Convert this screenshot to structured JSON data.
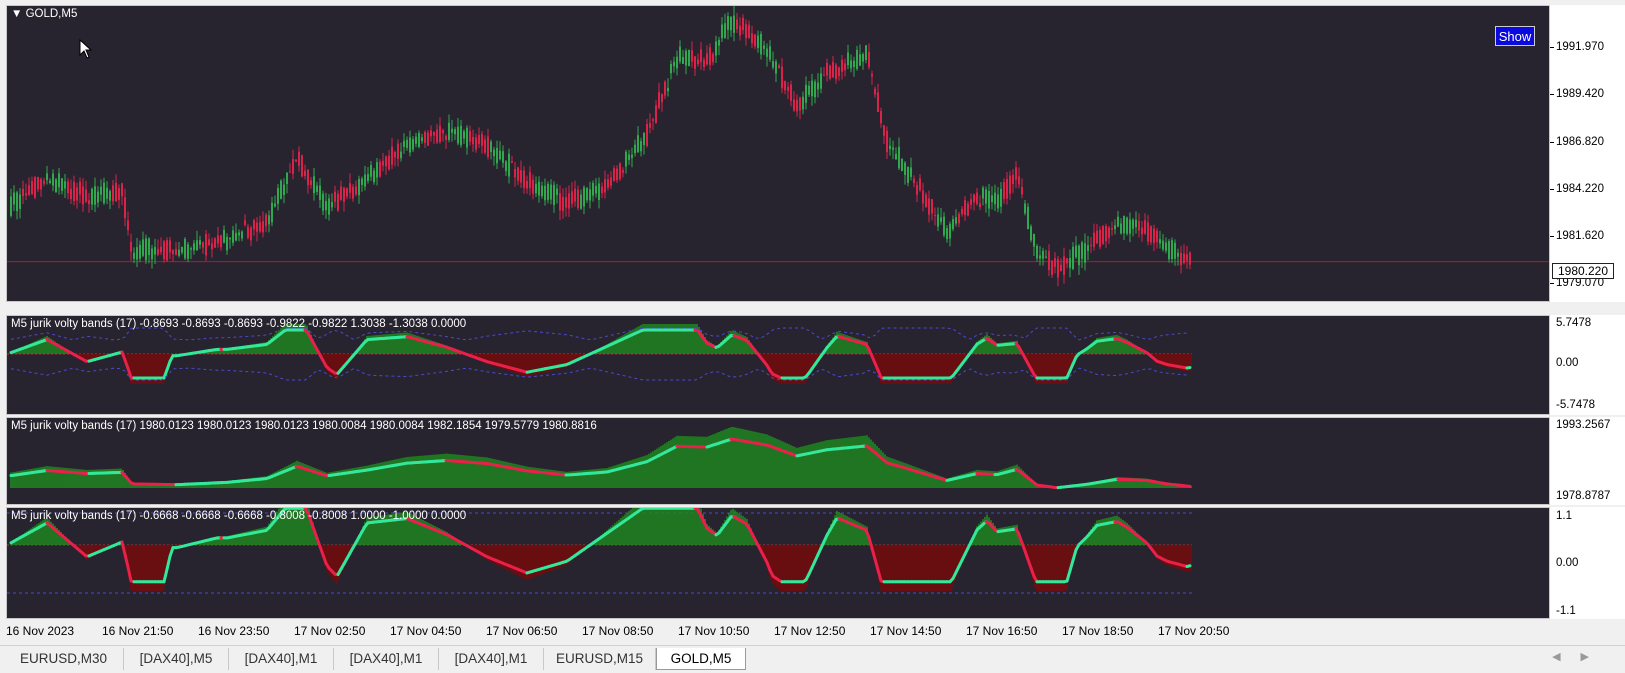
{
  "main_pane": {
    "title": "GOLD,M5",
    "show_button": "Show",
    "current_price": "1980.220",
    "price_ticks": [
      "1991.970",
      "1989.420",
      "1986.820",
      "1984.220",
      "1981.620",
      "1979.070"
    ],
    "colors": {
      "bull": "#2fa84f",
      "bear": "#d9234a",
      "price_line": "#cc1111",
      "background": "#27232f"
    }
  },
  "indicator_1": {
    "label": "M5 jurik volty bands  (17) -0.8693 -0.8693 -0.8693 -0.9822 -0.9822 1.3038 -1.3038 0.0000",
    "ticks": [
      "5.7478",
      "0.00",
      "-5.7478"
    ]
  },
  "indicator_2": {
    "label": "M5 jurik volty bands  (17) 1980.0123 1980.0123 1980.0123 1980.0084 1980.0084 1982.1854 1979.5779 1980.8816",
    "ticks": [
      "1993.2567",
      "1978.8787"
    ]
  },
  "indicator_3": {
    "label": "M5 jurik volty bands  (17) -0.6668 -0.6668 -0.6668 -0.8008 -0.8008 1.0000 -1.0000 0.0000",
    "ticks": [
      "1.1",
      "0.00",
      "-1.1"
    ]
  },
  "time_axis": [
    "16 Nov 2023",
    "16 Nov 21:50",
    "16 Nov 23:50",
    "17 Nov 02:50",
    "17 Nov 04:50",
    "17 Nov 06:50",
    "17 Nov 08:50",
    "17 Nov 10:50",
    "17 Nov 12:50",
    "17 Nov 14:50",
    "17 Nov 16:50",
    "17 Nov 18:50",
    "17 Nov 20:50"
  ],
  "tabs": [
    {
      "label": "EURUSD,M30"
    },
    {
      "label": "[DAX40],M5"
    },
    {
      "label": "[DAX40],M1"
    },
    {
      "label": "[DAX40],M1"
    },
    {
      "label": "[DAX40],M1"
    },
    {
      "label": "EURUSD,M15"
    },
    {
      "label": "GOLD,M5",
      "active": true
    }
  ],
  "colors": {
    "line_up": "#33e89a",
    "line_down": "#e8204a",
    "hist_up": "#1f8a1f",
    "hist_down": "#7a0a0a",
    "band": "#4a4ad0"
  }
}
